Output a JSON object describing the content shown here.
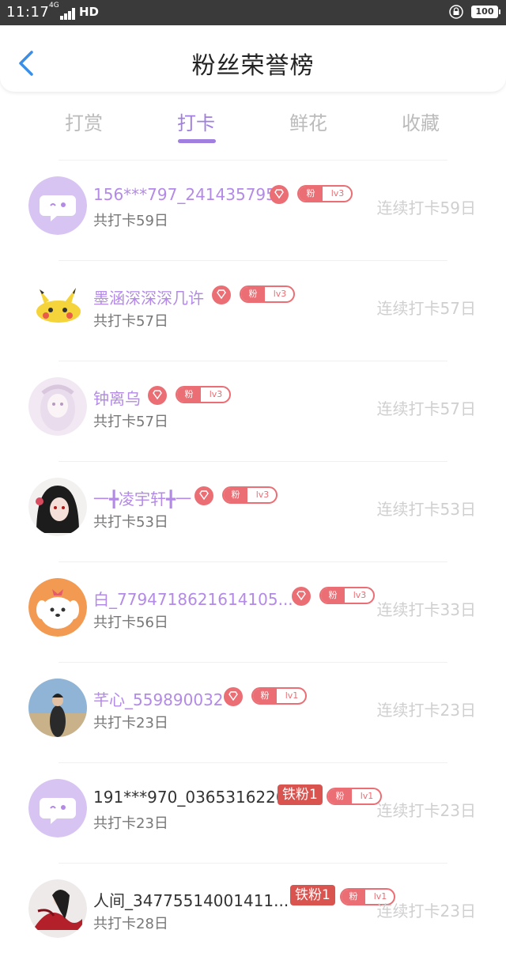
{
  "status_bar": {
    "time": "11:17",
    "network": "4G",
    "hd": "HD",
    "battery": "100"
  },
  "header": {
    "title": "粉丝荣誉榜"
  },
  "tabs": [
    {
      "label": "打赏",
      "active": false
    },
    {
      "label": "打卡",
      "active": true
    },
    {
      "label": "鲜花",
      "active": false
    },
    {
      "label": "收藏",
      "active": false
    }
  ],
  "fans": [
    {
      "name": "156***797_241435795",
      "total": "共打卡59日",
      "streak": "连续打卡59日",
      "fan_label": "粉",
      "level": "lv3",
      "avatar": "chat-bubble-avatar"
    },
    {
      "name": "墨涵深深深几许",
      "total": "共打卡57日",
      "streak": "连续打卡57日",
      "fan_label": "粉",
      "level": "lv3",
      "avatar": "pikachu-avatar"
    },
    {
      "name": "钟离乌",
      "total": "共打卡57日",
      "streak": "连续打卡57日",
      "fan_label": "粉",
      "level": "lv3",
      "avatar": "anime-girl-avatar"
    },
    {
      "name": "一╋凌宇轩╋一",
      "total": "共打卡53日",
      "streak": "连续打卡53日",
      "fan_label": "粉",
      "level": "lv3",
      "avatar": "dark-hair-avatar"
    },
    {
      "name": "白_7794718621614105...",
      "total": "共打卡56日",
      "streak": "连续打卡33日",
      "fan_label": "粉",
      "level": "lv3",
      "avatar": "puppy-avatar"
    },
    {
      "name": "芊心_559890032",
      "total": "共打卡23日",
      "streak": "连续打卡23日",
      "fan_label": "粉",
      "level": "lv1",
      "avatar": "photo-avatar"
    },
    {
      "name": "191***970_0365316220",
      "total": "共打卡23日",
      "streak": "连续打卡23日",
      "fan_label": "粉",
      "level": "lv1",
      "iron_badge": "铁粉1",
      "avatar": "chat-bubble-avatar"
    },
    {
      "name": "人间_34775514001411...",
      "total": "共打卡28日",
      "streak": "连续打卡23日",
      "fan_label": "粉",
      "level": "lv1",
      "iron_badge": "铁粉1",
      "avatar": "red-figure-avatar"
    }
  ],
  "colors": {
    "accent": "#a07fe0",
    "name": "#b38ae6",
    "badge": "#ea6e74",
    "iron_badge": "#d9534f",
    "muted": "#cfcfcf"
  }
}
